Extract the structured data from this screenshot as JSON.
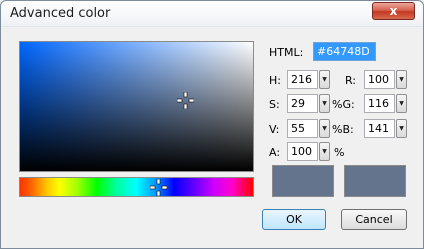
{
  "window": {
    "title": "Advanced color",
    "close_glyph": "x"
  },
  "picker": {
    "sv_area_icon": "color-gradient-area",
    "hue_strip_icon": "hue-spectrum-strip",
    "crosshair_icon": "crosshair-icon"
  },
  "fields": {
    "html": {
      "label": "HTML:",
      "value": "#64748D"
    },
    "h": {
      "label": "H:",
      "value": "216"
    },
    "s": {
      "label": "S:",
      "value": "29"
    },
    "v": {
      "label": "V:",
      "value": "55"
    },
    "r": {
      "label": "R:",
      "value": "100"
    },
    "g": {
      "label": "%G:",
      "value": "116"
    },
    "b": {
      "label": "%B:",
      "value": "141"
    },
    "a": {
      "label": "A:",
      "value": "100",
      "unit": "%"
    }
  },
  "spin_glyph": "▼",
  "preview": {
    "new_color": "#64748D",
    "old_color": "#64748D"
  },
  "buttons": {
    "ok": "OK",
    "cancel": "Cancel"
  },
  "colors": {
    "selection_highlight": "#3399ff",
    "current_hue": "#0066ff"
  }
}
